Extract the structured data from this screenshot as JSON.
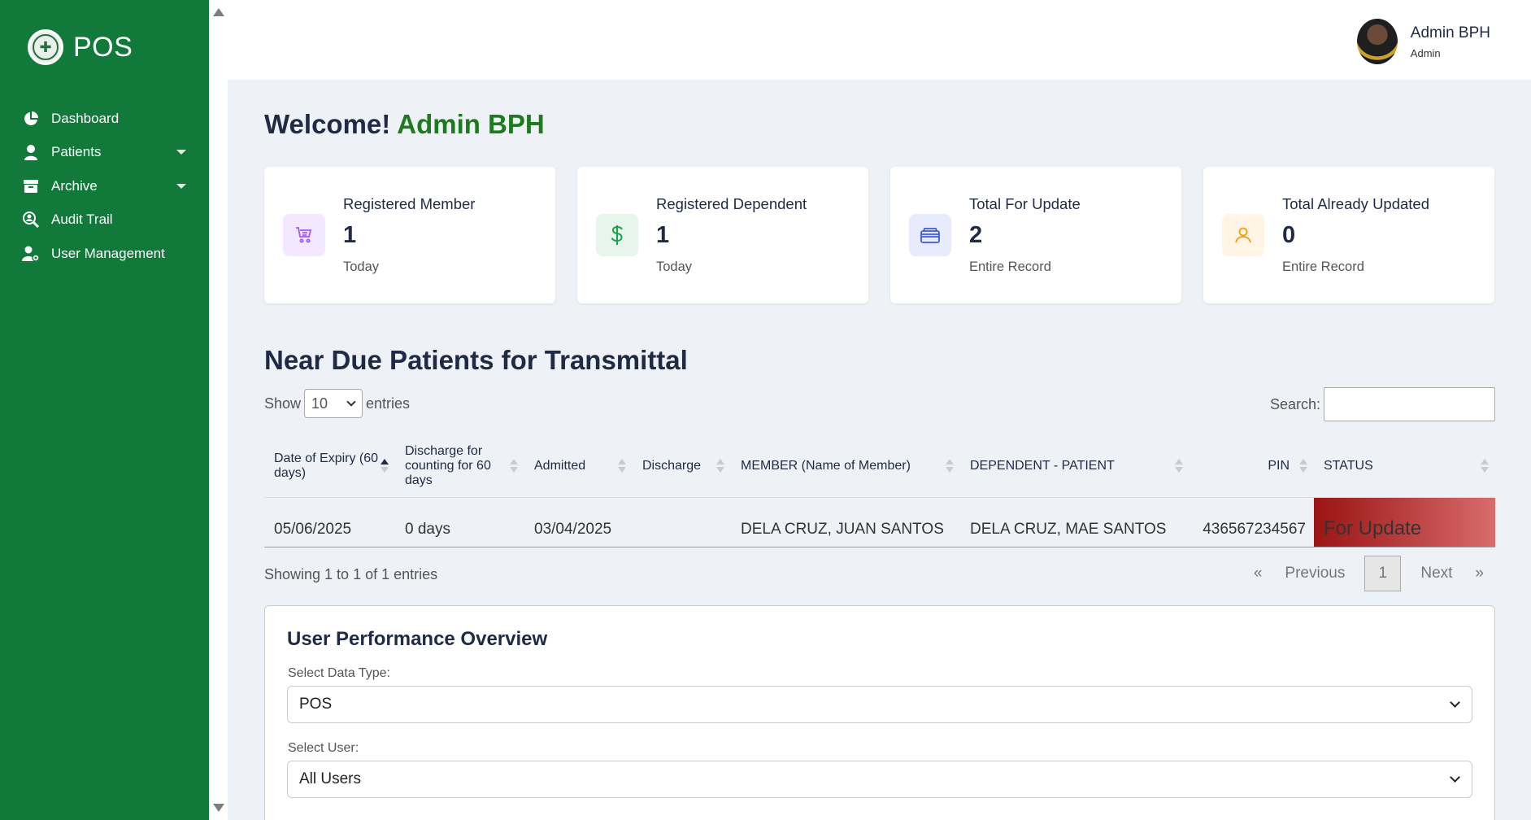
{
  "brand": {
    "title": "POS"
  },
  "sidebar": {
    "items": [
      {
        "label": "Dashboard",
        "icon": "pie-chart-icon"
      },
      {
        "label": "Patients",
        "icon": "user-icon",
        "has_dropdown": true
      },
      {
        "label": "Archive",
        "icon": "archive-box-icon",
        "has_dropdown": true
      },
      {
        "label": "Audit Trail",
        "icon": "search-user-icon"
      },
      {
        "label": "User Management",
        "icon": "users-gear-icon"
      }
    ]
  },
  "header": {
    "user_name": "Admin BPH",
    "user_role": "Admin"
  },
  "welcome": {
    "prefix": "Welcome!",
    "name": "Admin BPH"
  },
  "cards": [
    {
      "title": "Registered Member",
      "value": "1",
      "sub": "Today",
      "icon": "cart-icon",
      "color": "#a855f7",
      "bg": "#f3e8ff"
    },
    {
      "title": "Registered Dependent",
      "value": "1",
      "sub": "Today",
      "icon": "dollar-icon",
      "color": "#16a34a",
      "bg": "#e7f5ec"
    },
    {
      "title": "Total For Update",
      "value": "2",
      "sub": "Entire Record",
      "icon": "credit-card-icon",
      "color": "#3b5bdb",
      "bg": "#e7ebfb"
    },
    {
      "title": "Total Already Updated",
      "value": "0",
      "sub": "Entire Record",
      "icon": "user-outline-icon",
      "color": "#f59e0b",
      "bg": "#fff4e5"
    }
  ],
  "table_section": {
    "title": "Near Due Patients for Transmittal",
    "show_label": "Show",
    "entries_value": "10",
    "entries_label": "entries",
    "search_label": "Search:",
    "columns": [
      "Date of Expiry (60 days)",
      "Discharge for counting for 60 days",
      "Admitted",
      "Discharge",
      "MEMBER (Name of Member)",
      "DEPENDENT - PATIENT",
      "PIN",
      "STATUS"
    ],
    "rows": [
      [
        "05/06/2025",
        "0 days",
        "03/04/2025",
        "",
        "DELA CRUZ, JUAN SANTOS",
        "DELA CRUZ, MAE SANTOS",
        "436567234567",
        "For Update"
      ]
    ],
    "info": "Showing 1 to 1 of 1 entries",
    "pager": {
      "first": "«",
      "prev": "Previous",
      "current": "1",
      "next": "Next",
      "last": "»"
    }
  },
  "performance": {
    "title": "User Performance Overview",
    "data_type_label": "Select Data Type:",
    "data_type_value": "POS",
    "user_label": "Select User:",
    "user_value": "All Users"
  },
  "colors": {
    "sidebar": "#117a3a",
    "accent_name": "#1d7a1f",
    "status_bg": "#9b1414"
  }
}
